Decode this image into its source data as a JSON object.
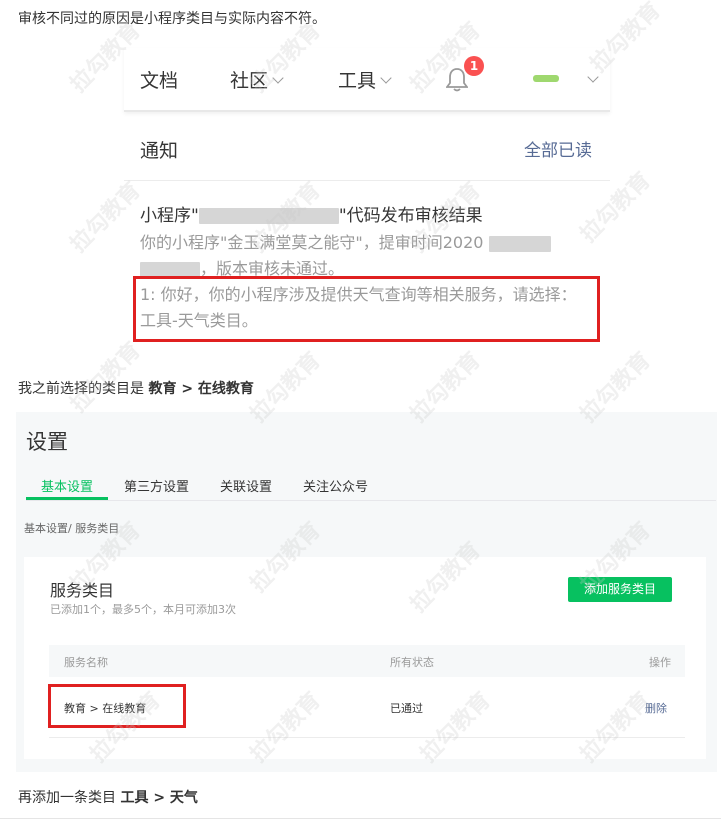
{
  "intro_text": "审核不同过的原因是小程序类目与实际内容不符。",
  "nav": {
    "docs": "文档",
    "community": "社区",
    "tools": "工具",
    "notification_count": "1"
  },
  "notice": {
    "title": "通知",
    "mark_all_read": "全部已读",
    "message_title_prefix": "小程序\"",
    "message_title_suffix": "\"代码发布审核结果",
    "message_line1_prefix": "你的小程序\"金玉满堂莫之能守\"，提审时间2020",
    "message_line2_suffix": "，版本审核未通过。",
    "reason": "1: 你好，你的小程序涉及提供天气查询等相关服务，请选择：工具-天气类目。"
  },
  "middle_text_prefix": "我之前选择的类目是 ",
  "middle_text_bold": "教育 > 在线教育",
  "settings": {
    "title": "设置",
    "tabs": [
      "基本设置",
      "第三方设置",
      "关联设置",
      "关注公众号"
    ],
    "breadcrumb": "基本设置/ 服务类目",
    "card_title": "服务类目",
    "card_subtitle": "已添加1个，最多5个，本月可添加3次",
    "add_button": "添加服务类目",
    "columns": [
      "服务名称",
      "所有状态",
      "操作"
    ],
    "rows": [
      {
        "name": "教育 > 在线教育",
        "status": "已通过",
        "action": "删除"
      }
    ]
  },
  "footer_text_prefix": "再添加一条类目 ",
  "footer_text_bold": "工具 > 天气",
  "colors": {
    "accent_green": "#07c160",
    "link_blue": "#576b95",
    "badge_red": "#fa5151",
    "highlight_red": "#e02020"
  },
  "watermark": "拉勾教育"
}
